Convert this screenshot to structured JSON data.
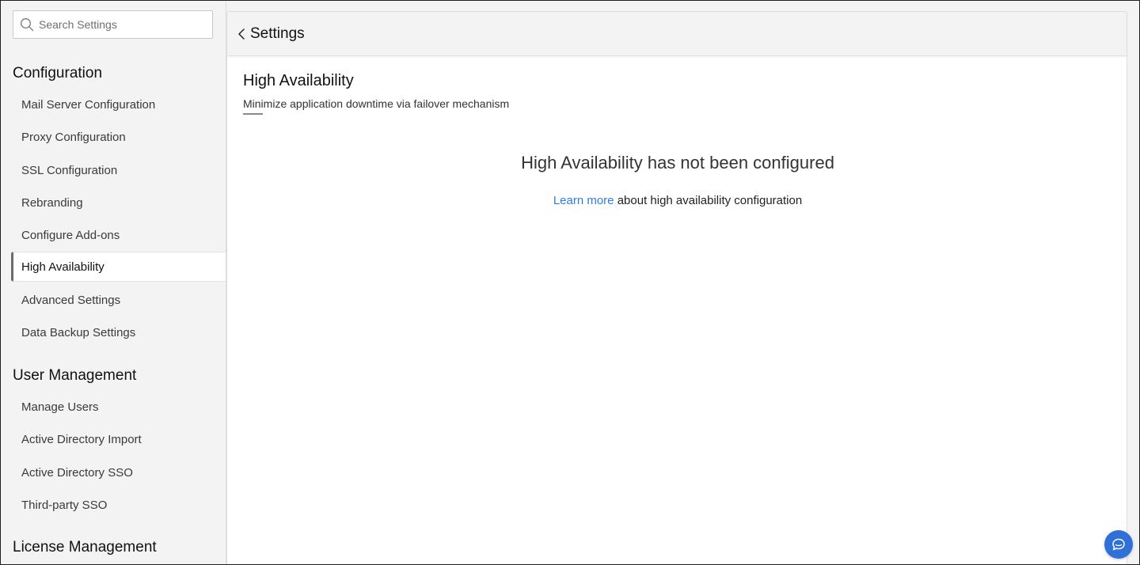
{
  "search": {
    "placeholder": "Search Settings",
    "value": ""
  },
  "sidebar": {
    "groups": [
      {
        "title": "Configuration",
        "items": [
          {
            "label": "Mail Server Configuration"
          },
          {
            "label": "Proxy Configuration"
          },
          {
            "label": "SSL Configuration"
          },
          {
            "label": "Rebranding"
          },
          {
            "label": "Configure Add-ons"
          },
          {
            "label": "High Availability",
            "active": true
          },
          {
            "label": "Advanced Settings"
          },
          {
            "label": "Data Backup Settings"
          }
        ]
      },
      {
        "title": "User Management",
        "items": [
          {
            "label": "Manage Users"
          },
          {
            "label": "Active Directory Import"
          },
          {
            "label": "Active Directory SSO"
          },
          {
            "label": "Third-party SSO"
          }
        ]
      },
      {
        "title": "License Management",
        "items": []
      }
    ]
  },
  "header": {
    "back_label": "Settings",
    "back_icon": "chevron-left-icon"
  },
  "main": {
    "title": "High Availability",
    "subtitle": "Minimize application downtime via failover mechanism",
    "empty_state": {
      "heading": "High Availability has not been configured",
      "link_text": "Learn more",
      "text_after_link": " about high availability configuration"
    }
  },
  "chat": {
    "icon": "chat-icon"
  },
  "colors": {
    "accent": "#2f7de1",
    "chat_button": "#2f6fd8",
    "sidebar_bg": "#f3f3f3",
    "active_indicator": "#6b6b6b"
  }
}
